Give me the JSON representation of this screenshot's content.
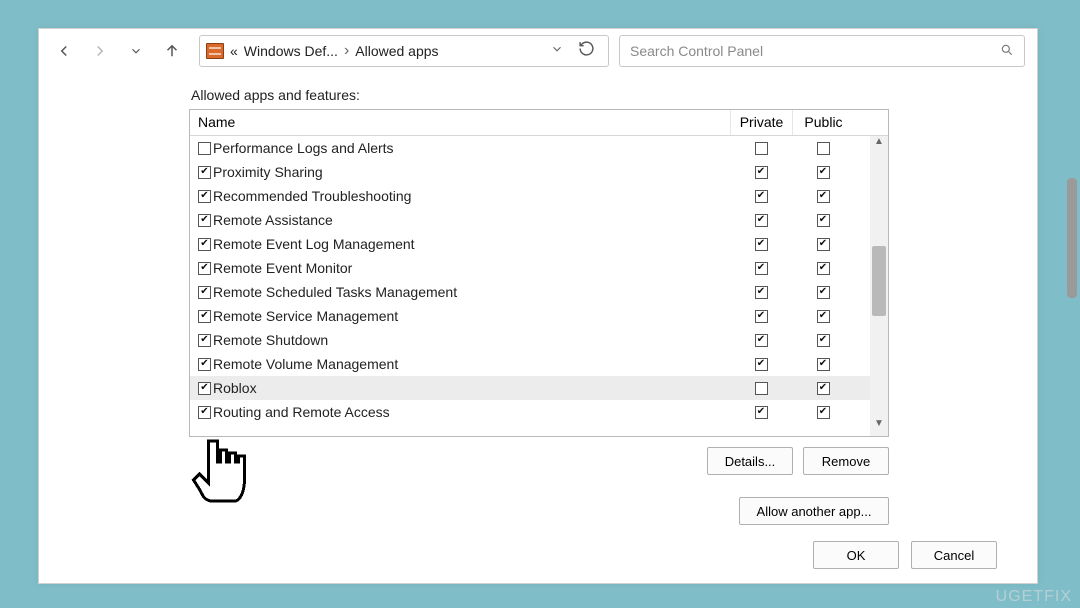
{
  "toolbar": {
    "breadcrumb": {
      "seg1": "Windows Def...",
      "seg2": "Allowed apps",
      "prefix": "«"
    },
    "search_placeholder": "Search Control Panel"
  },
  "section_label": "Allowed apps and features:",
  "columns": {
    "name": "Name",
    "private": "Private",
    "public": "Public"
  },
  "rows": [
    {
      "name": "Performance Logs and Alerts",
      "en": false,
      "priv": false,
      "pub": false,
      "sel": false
    },
    {
      "name": "Proximity Sharing",
      "en": true,
      "priv": true,
      "pub": true,
      "sel": false
    },
    {
      "name": "Recommended Troubleshooting",
      "en": true,
      "priv": true,
      "pub": true,
      "sel": false
    },
    {
      "name": "Remote Assistance",
      "en": true,
      "priv": true,
      "pub": true,
      "sel": false
    },
    {
      "name": "Remote Event Log Management",
      "en": true,
      "priv": true,
      "pub": true,
      "sel": false
    },
    {
      "name": "Remote Event Monitor",
      "en": true,
      "priv": true,
      "pub": true,
      "sel": false
    },
    {
      "name": "Remote Scheduled Tasks Management",
      "en": true,
      "priv": true,
      "pub": true,
      "sel": false
    },
    {
      "name": "Remote Service Management",
      "en": true,
      "priv": true,
      "pub": true,
      "sel": false
    },
    {
      "name": "Remote Shutdown",
      "en": true,
      "priv": true,
      "pub": true,
      "sel": false
    },
    {
      "name": "Remote Volume Management",
      "en": true,
      "priv": true,
      "pub": true,
      "sel": false
    },
    {
      "name": "Roblox",
      "en": true,
      "priv": false,
      "pub": true,
      "sel": true
    },
    {
      "name": "Routing and Remote Access",
      "en": true,
      "priv": true,
      "pub": true,
      "sel": false
    }
  ],
  "buttons": {
    "details": "Details...",
    "remove": "Remove",
    "allow_another": "Allow another app...",
    "ok": "OK",
    "cancel": "Cancel"
  },
  "watermark": "UGETFIX"
}
